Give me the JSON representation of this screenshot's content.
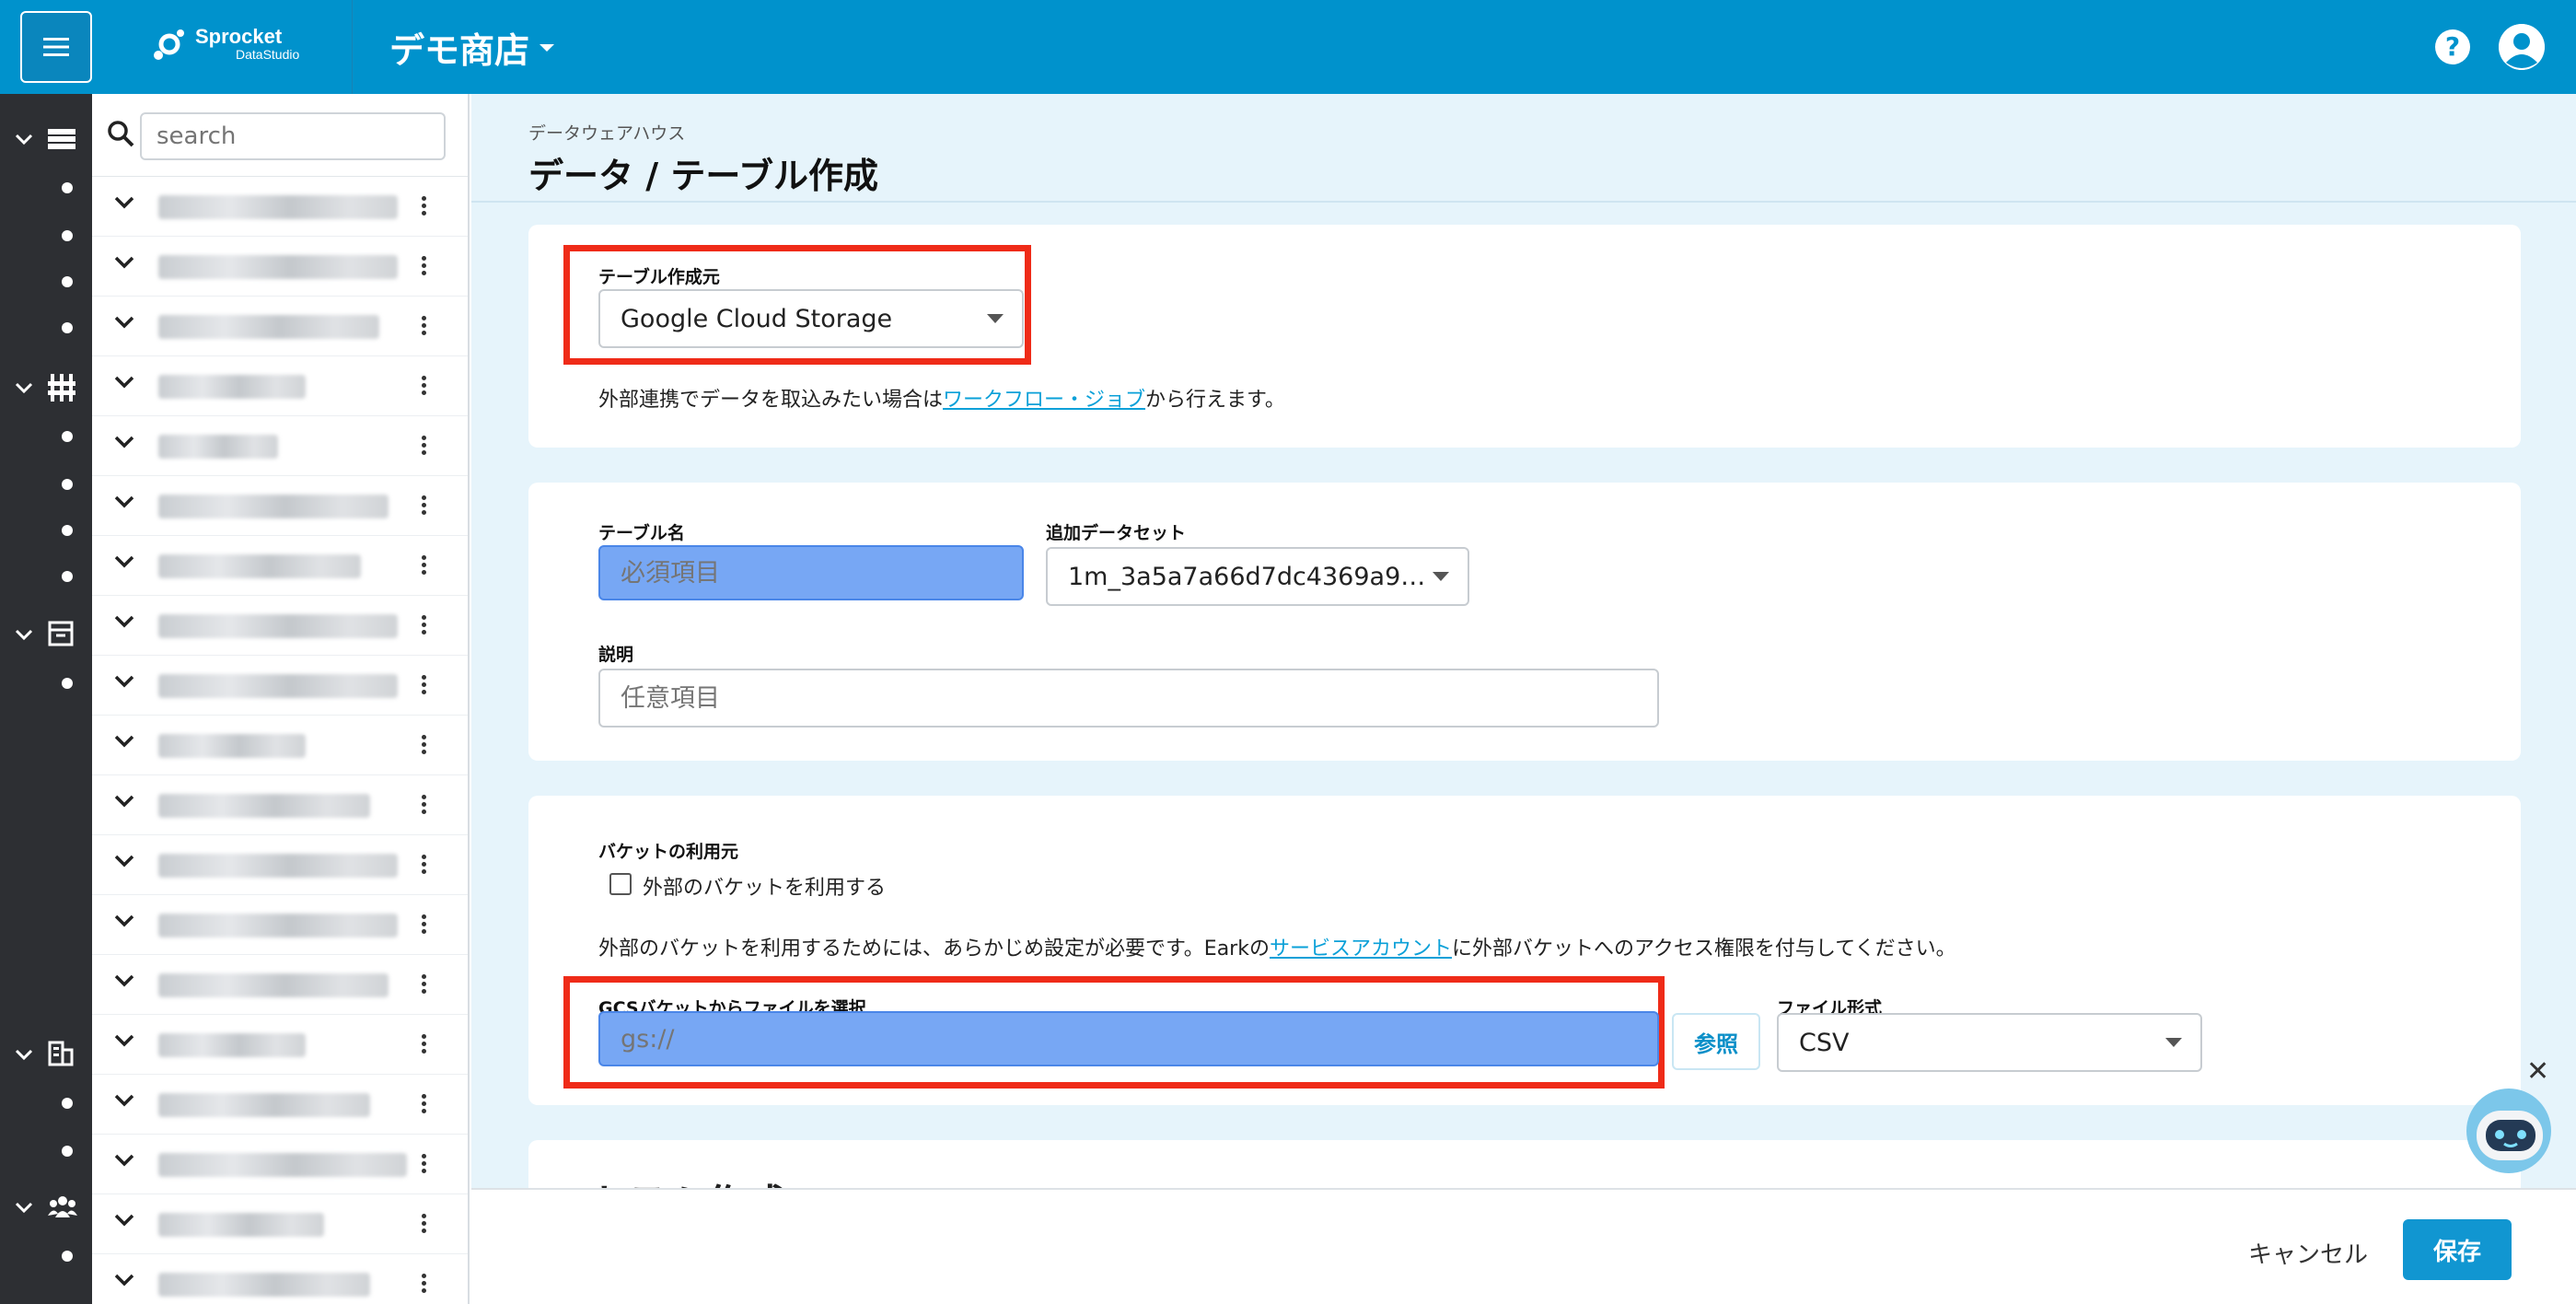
{
  "header": {
    "logo_name": "Sprocket",
    "logo_sub": "DataStudio",
    "store_name": "デモ商店",
    "help_label": "?"
  },
  "search": {
    "placeholder": "search"
  },
  "tree": {
    "row_count": 19
  },
  "page": {
    "breadcrumb": "データウェアハウス",
    "title": "データ / テーブル作成"
  },
  "source_card": {
    "label": "テーブル作成元",
    "value": "Google Cloud Storage",
    "note_before": "外部連携でデータを取込みたい場合は",
    "note_link": "ワークフロー・ジョブ",
    "note_after": "から行えます。"
  },
  "table_card": {
    "name_label": "テーブル名",
    "name_placeholder": "必須項目",
    "dataset_label": "追加データセット",
    "dataset_value": "1m_3a5a7a66d7dc4369a9…",
    "desc_label": "説明",
    "desc_placeholder": "任意項目"
  },
  "bucket_card": {
    "label": "バケットの利用元",
    "checkbox_label": "外部のバケットを利用する",
    "note_before": "外部のバケットを利用するためには、あらかじめ設定が必要です。Earkの",
    "note_link": "サービスアカウント",
    "note_after": "に外部バケットへのアクセス権限を付与してください。",
    "gcs_label": "GCSバケットからファイルを選択",
    "gcs_placeholder": "gs://",
    "browse_label": "参照",
    "format_label": "ファイル形式",
    "format_value": "CSV"
  },
  "cut_section": {
    "heading": "カラム作成"
  },
  "footer": {
    "cancel_label": "キャンセル",
    "save_label": "保存"
  },
  "colors": {
    "header_bg": "#0092cc",
    "rail_bg": "#2d2f33",
    "main_bg": "#e6f4fb",
    "highlight_input": "#77a7f4",
    "red_box": "#ef2b18",
    "save_btn": "#1196d1",
    "link": "#0aa0d8"
  }
}
